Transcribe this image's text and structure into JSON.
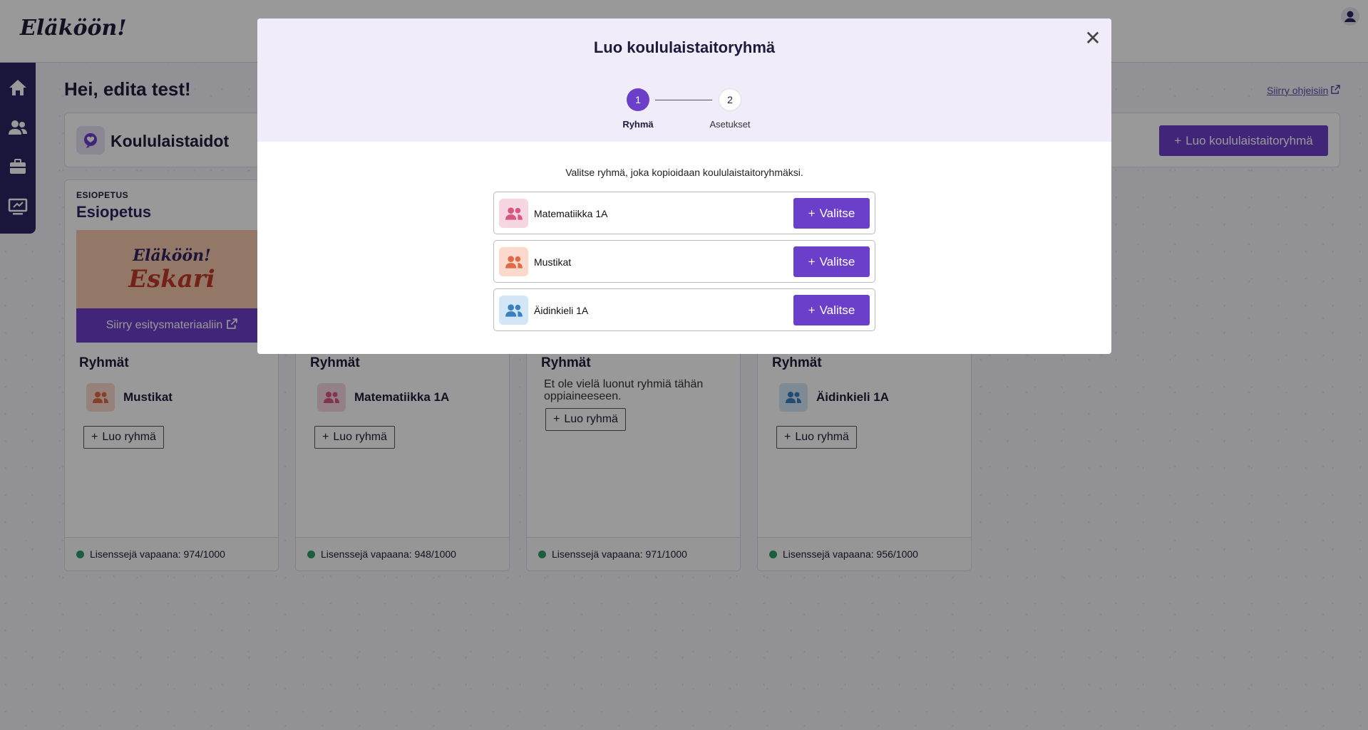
{
  "app": {
    "logo": "Eläköön!"
  },
  "colors": {
    "brand": "#6b3fc9",
    "sidebar": "#2b2463",
    "license_ok": "#2e9b6a"
  },
  "sidebar": {
    "items": [
      {
        "icon": "home-icon"
      },
      {
        "icon": "users-icon"
      },
      {
        "icon": "briefcase-icon"
      },
      {
        "icon": "presentation-icon"
      }
    ]
  },
  "main": {
    "greeting": "Hei, edita test!",
    "help_link": "Siirry ohjeisiin",
    "section_title": "Koululaistaidot",
    "create_button": "Luo koululaistaitoryhmä",
    "cards": [
      {
        "kicker": "ESIOPETUS",
        "title": "Esiopetus",
        "banner_line1": "Eläköön!",
        "banner_line2": "Eskari",
        "banner_link": "Siirry esitysmateriaaliin",
        "groups_heading": "Ryhmät",
        "group": "Mustikat",
        "create_group": "Luo ryhmä",
        "license": "Lisenssejä vapaana: 974/1000"
      },
      {
        "groups_heading": "Ryhmät",
        "group": "Matematiikka 1A",
        "create_group": "Luo ryhmä",
        "license": "Lisenssejä vapaana: 948/1000"
      },
      {
        "groups_heading": "Ryhmät",
        "empty_text": "Et ole vielä luonut ryhmiä tähän oppiaineeseen.",
        "create_group": "Luo ryhmä",
        "license": "Lisenssejä vapaana: 971/1000"
      },
      {
        "groups_heading": "Ryhmät",
        "group": "Äidinkieli 1A",
        "create_group": "Luo ryhmä",
        "license": "Lisenssejä vapaana: 956/1000"
      }
    ]
  },
  "modal": {
    "title": "Luo koululaistaitoryhmä",
    "steps": [
      {
        "number": "1",
        "label": "Ryhmä",
        "active": true
      },
      {
        "number": "2",
        "label": "Asetukset",
        "active": false
      }
    ],
    "instruction": "Valitse ryhmä, joka kopioidaan koululaistaitoryhmäksi.",
    "select_label": "Valitse",
    "groups": [
      {
        "name": "Matematiikka 1A",
        "color": "#f7d6e4",
        "icon_color": "#d9577f"
      },
      {
        "name": "Mustikat",
        "color": "#fbd9cc",
        "icon_color": "#e06a47"
      },
      {
        "name": "Äidinkieli 1A",
        "color": "#d3e6f7",
        "icon_color": "#3a7fc0"
      }
    ]
  }
}
